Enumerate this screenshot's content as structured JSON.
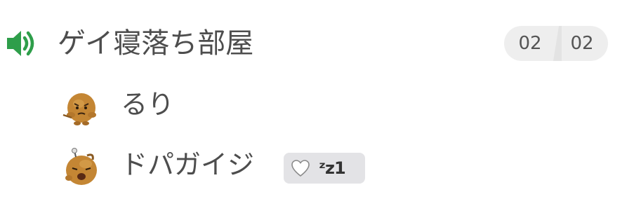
{
  "channel": {
    "name": "ゲイ寝落ち部屋",
    "icon": "speaker-icon",
    "icon_color": "#2e9e4a",
    "count_left": "02",
    "count_right": "02"
  },
  "members": [
    {
      "name": "るり",
      "avatar": "potato-character-avatar"
    },
    {
      "name": "ドパガイジ",
      "avatar": "potato-character-baby-avatar",
      "status": {
        "icon": "white-heart-icon",
        "text": "ᶻz1"
      }
    }
  ]
}
